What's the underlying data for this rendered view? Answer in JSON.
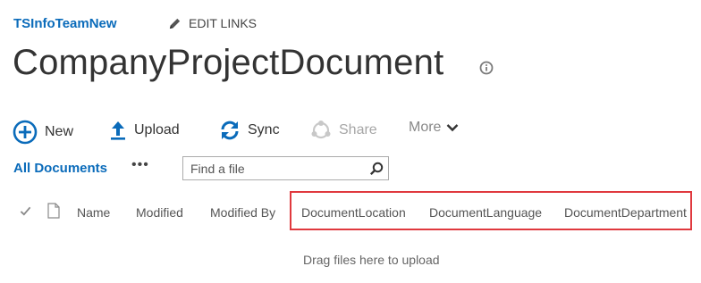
{
  "site": {
    "name": "TSInfoTeamNew",
    "edit_links_label": "EDIT LINKS"
  },
  "page": {
    "title": "CompanyProjectDocument"
  },
  "commands": {
    "new_label": "New",
    "upload_label": "Upload",
    "sync_label": "Sync",
    "share_label": "Share",
    "more_label": "More"
  },
  "view": {
    "name": "All Documents",
    "more_options": "•••",
    "search_placeholder": "Find a file"
  },
  "columns": {
    "name": "Name",
    "modified": "Modified",
    "modified_by": "Modified By",
    "document_location": "DocumentLocation",
    "document_language": "DocumentLanguage",
    "document_department": "DocumentDepartment"
  },
  "empty_state": {
    "drop_hint": "Drag files here to upload"
  },
  "colors": {
    "link_blue": "#0a6bba",
    "icon_blue": "#0a6bba",
    "disabled_gray": "#a6a6a6",
    "highlight_red": "#e0393e"
  },
  "icons": {
    "edit": "pencil-icon",
    "info": "info-icon",
    "new": "plus-circle-icon",
    "upload": "upload-arrow-icon",
    "sync": "sync-icon",
    "share": "share-icon",
    "more": "chevron-down-icon",
    "search": "search-icon",
    "select": "check-icon",
    "type": "document-icon"
  }
}
